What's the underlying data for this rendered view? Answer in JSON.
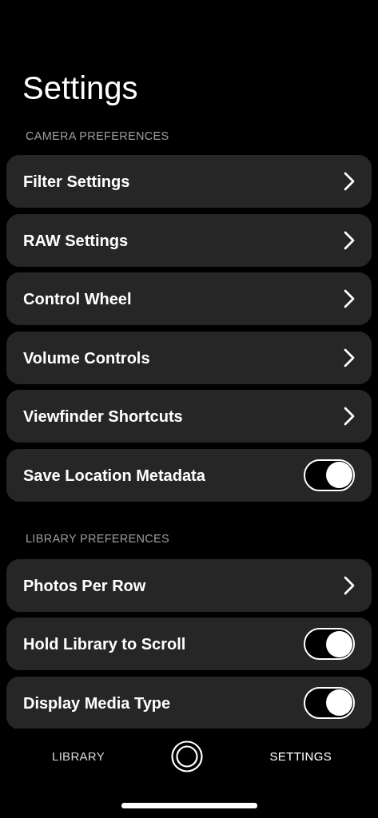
{
  "title": "Settings",
  "sections": [
    {
      "header": "CAMERA PREFERENCES",
      "rows": [
        {
          "kind": "link",
          "label": "Filter Settings"
        },
        {
          "kind": "link",
          "label": "RAW Settings"
        },
        {
          "kind": "link",
          "label": "Control Wheel"
        },
        {
          "kind": "link",
          "label": "Volume Controls"
        },
        {
          "kind": "link",
          "label": "Viewfinder Shortcuts"
        },
        {
          "kind": "toggle",
          "label": "Save Location Metadata",
          "on": true
        }
      ]
    },
    {
      "header": "LIBRARY PREFERENCES",
      "rows": [
        {
          "kind": "link",
          "label": "Photos Per Row"
        },
        {
          "kind": "toggle",
          "label": "Hold Library to Scroll",
          "on": true
        },
        {
          "kind": "toggle",
          "label": "Display Media Type",
          "on": true
        }
      ]
    }
  ],
  "tabs": [
    {
      "label": "LIBRARY",
      "selected": false
    },
    {
      "label": "SETTINGS",
      "selected": true
    }
  ]
}
